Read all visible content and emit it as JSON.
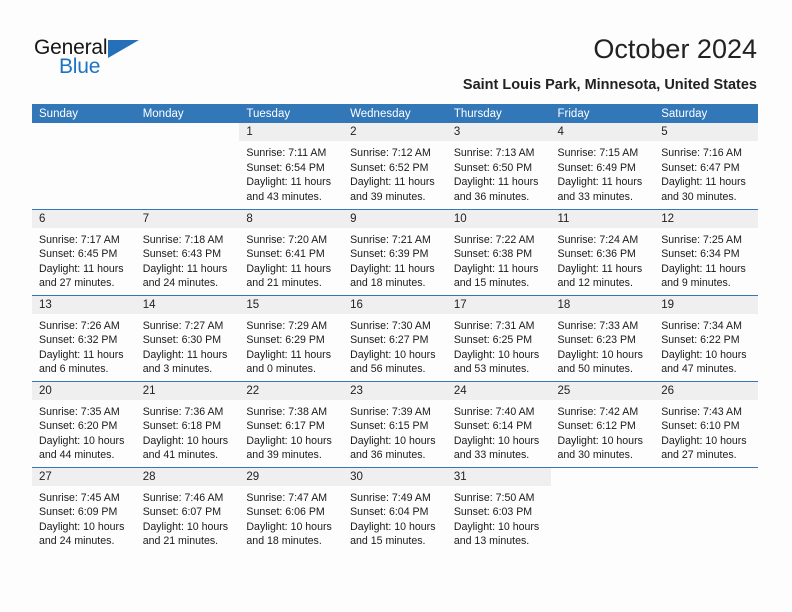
{
  "brand": {
    "name_part1": "General",
    "name_part2": "Blue",
    "triangle_color": "#2570b8",
    "blue_text_color": "#1c74c4"
  },
  "header": {
    "title": "October 2024",
    "subtitle": "Saint Louis Park, Minnesota, United States"
  },
  "theme": {
    "header_blue": "#3277b8",
    "daynum_gray": "#efefef",
    "page_background": "#fdfdfd"
  },
  "calendar": {
    "weekday_headers": [
      "Sunday",
      "Monday",
      "Tuesday",
      "Wednesday",
      "Thursday",
      "Friday",
      "Saturday"
    ],
    "weeks": [
      [
        {
          "day": "",
          "sunrise": "",
          "sunset": "",
          "daylight": ""
        },
        {
          "day": "",
          "sunrise": "",
          "sunset": "",
          "daylight": ""
        },
        {
          "day": "1",
          "sunrise": "Sunrise: 7:11 AM",
          "sunset": "Sunset: 6:54 PM",
          "daylight": "Daylight: 11 hours and 43 minutes."
        },
        {
          "day": "2",
          "sunrise": "Sunrise: 7:12 AM",
          "sunset": "Sunset: 6:52 PM",
          "daylight": "Daylight: 11 hours and 39 minutes."
        },
        {
          "day": "3",
          "sunrise": "Sunrise: 7:13 AM",
          "sunset": "Sunset: 6:50 PM",
          "daylight": "Daylight: 11 hours and 36 minutes."
        },
        {
          "day": "4",
          "sunrise": "Sunrise: 7:15 AM",
          "sunset": "Sunset: 6:49 PM",
          "daylight": "Daylight: 11 hours and 33 minutes."
        },
        {
          "day": "5",
          "sunrise": "Sunrise: 7:16 AM",
          "sunset": "Sunset: 6:47 PM",
          "daylight": "Daylight: 11 hours and 30 minutes."
        }
      ],
      [
        {
          "day": "6",
          "sunrise": "Sunrise: 7:17 AM",
          "sunset": "Sunset: 6:45 PM",
          "daylight": "Daylight: 11 hours and 27 minutes."
        },
        {
          "day": "7",
          "sunrise": "Sunrise: 7:18 AM",
          "sunset": "Sunset: 6:43 PM",
          "daylight": "Daylight: 11 hours and 24 minutes."
        },
        {
          "day": "8",
          "sunrise": "Sunrise: 7:20 AM",
          "sunset": "Sunset: 6:41 PM",
          "daylight": "Daylight: 11 hours and 21 minutes."
        },
        {
          "day": "9",
          "sunrise": "Sunrise: 7:21 AM",
          "sunset": "Sunset: 6:39 PM",
          "daylight": "Daylight: 11 hours and 18 minutes."
        },
        {
          "day": "10",
          "sunrise": "Sunrise: 7:22 AM",
          "sunset": "Sunset: 6:38 PM",
          "daylight": "Daylight: 11 hours and 15 minutes."
        },
        {
          "day": "11",
          "sunrise": "Sunrise: 7:24 AM",
          "sunset": "Sunset: 6:36 PM",
          "daylight": "Daylight: 11 hours and 12 minutes."
        },
        {
          "day": "12",
          "sunrise": "Sunrise: 7:25 AM",
          "sunset": "Sunset: 6:34 PM",
          "daylight": "Daylight: 11 hours and 9 minutes."
        }
      ],
      [
        {
          "day": "13",
          "sunrise": "Sunrise: 7:26 AM",
          "sunset": "Sunset: 6:32 PM",
          "daylight": "Daylight: 11 hours and 6 minutes."
        },
        {
          "day": "14",
          "sunrise": "Sunrise: 7:27 AM",
          "sunset": "Sunset: 6:30 PM",
          "daylight": "Daylight: 11 hours and 3 minutes."
        },
        {
          "day": "15",
          "sunrise": "Sunrise: 7:29 AM",
          "sunset": "Sunset: 6:29 PM",
          "daylight": "Daylight: 11 hours and 0 minutes."
        },
        {
          "day": "16",
          "sunrise": "Sunrise: 7:30 AM",
          "sunset": "Sunset: 6:27 PM",
          "daylight": "Daylight: 10 hours and 56 minutes."
        },
        {
          "day": "17",
          "sunrise": "Sunrise: 7:31 AM",
          "sunset": "Sunset: 6:25 PM",
          "daylight": "Daylight: 10 hours and 53 minutes."
        },
        {
          "day": "18",
          "sunrise": "Sunrise: 7:33 AM",
          "sunset": "Sunset: 6:23 PM",
          "daylight": "Daylight: 10 hours and 50 minutes."
        },
        {
          "day": "19",
          "sunrise": "Sunrise: 7:34 AM",
          "sunset": "Sunset: 6:22 PM",
          "daylight": "Daylight: 10 hours and 47 minutes."
        }
      ],
      [
        {
          "day": "20",
          "sunrise": "Sunrise: 7:35 AM",
          "sunset": "Sunset: 6:20 PM",
          "daylight": "Daylight: 10 hours and 44 minutes."
        },
        {
          "day": "21",
          "sunrise": "Sunrise: 7:36 AM",
          "sunset": "Sunset: 6:18 PM",
          "daylight": "Daylight: 10 hours and 41 minutes."
        },
        {
          "day": "22",
          "sunrise": "Sunrise: 7:38 AM",
          "sunset": "Sunset: 6:17 PM",
          "daylight": "Daylight: 10 hours and 39 minutes."
        },
        {
          "day": "23",
          "sunrise": "Sunrise: 7:39 AM",
          "sunset": "Sunset: 6:15 PM",
          "daylight": "Daylight: 10 hours and 36 minutes."
        },
        {
          "day": "24",
          "sunrise": "Sunrise: 7:40 AM",
          "sunset": "Sunset: 6:14 PM",
          "daylight": "Daylight: 10 hours and 33 minutes."
        },
        {
          "day": "25",
          "sunrise": "Sunrise: 7:42 AM",
          "sunset": "Sunset: 6:12 PM",
          "daylight": "Daylight: 10 hours and 30 minutes."
        },
        {
          "day": "26",
          "sunrise": "Sunrise: 7:43 AM",
          "sunset": "Sunset: 6:10 PM",
          "daylight": "Daylight: 10 hours and 27 minutes."
        }
      ],
      [
        {
          "day": "27",
          "sunrise": "Sunrise: 7:45 AM",
          "sunset": "Sunset: 6:09 PM",
          "daylight": "Daylight: 10 hours and 24 minutes."
        },
        {
          "day": "28",
          "sunrise": "Sunrise: 7:46 AM",
          "sunset": "Sunset: 6:07 PM",
          "daylight": "Daylight: 10 hours and 21 minutes."
        },
        {
          "day": "29",
          "sunrise": "Sunrise: 7:47 AM",
          "sunset": "Sunset: 6:06 PM",
          "daylight": "Daylight: 10 hours and 18 minutes."
        },
        {
          "day": "30",
          "sunrise": "Sunrise: 7:49 AM",
          "sunset": "Sunset: 6:04 PM",
          "daylight": "Daylight: 10 hours and 15 minutes."
        },
        {
          "day": "31",
          "sunrise": "Sunrise: 7:50 AM",
          "sunset": "Sunset: 6:03 PM",
          "daylight": "Daylight: 10 hours and 13 minutes."
        },
        {
          "day": "",
          "sunrise": "",
          "sunset": "",
          "daylight": ""
        },
        {
          "day": "",
          "sunrise": "",
          "sunset": "",
          "daylight": ""
        }
      ]
    ]
  }
}
